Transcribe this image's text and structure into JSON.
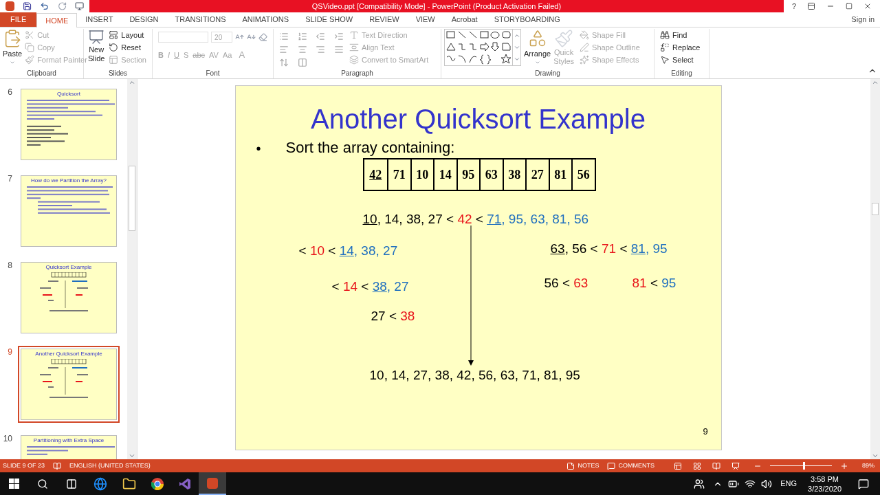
{
  "title_bar": {
    "title": "QSVideo.ppt [Compatibility Mode] - PowerPoint (Product Activation Failed)",
    "help": "?"
  },
  "tabs": [
    {
      "label": "FILE",
      "kind": "file",
      "selected": false
    },
    {
      "label": "HOME",
      "kind": "tab",
      "selected": true
    },
    {
      "label": "INSERT",
      "kind": "tab",
      "selected": false
    },
    {
      "label": "DESIGN",
      "kind": "tab",
      "selected": false
    },
    {
      "label": "TRANSITIONS",
      "kind": "tab",
      "selected": false
    },
    {
      "label": "ANIMATIONS",
      "kind": "tab",
      "selected": false
    },
    {
      "label": "SLIDE SHOW",
      "kind": "tab",
      "selected": false
    },
    {
      "label": "REVIEW",
      "kind": "tab",
      "selected": false
    },
    {
      "label": "VIEW",
      "kind": "tab",
      "selected": false
    },
    {
      "label": "Acrobat",
      "kind": "tab",
      "selected": false
    },
    {
      "label": "STORYBOARDING",
      "kind": "tab",
      "selected": false
    }
  ],
  "sign_in": "Sign in",
  "clipboard": {
    "label": "Clipboard",
    "paste": "Paste",
    "items": [
      {
        "label": "Cut",
        "disabled": true
      },
      {
        "label": "Copy",
        "disabled": true
      },
      {
        "label": "Format Painter",
        "disabled": true
      }
    ]
  },
  "slides_group": {
    "label": "Slides",
    "new_slide": [
      "New",
      "Slide"
    ],
    "items": [
      {
        "label": "Layout",
        "disabled": false
      },
      {
        "label": "Reset",
        "disabled": false
      },
      {
        "label": "Section",
        "disabled": true
      }
    ]
  },
  "font": {
    "label": "Font",
    "size": "20",
    "buttons": [
      "B",
      "I",
      "U",
      "S",
      "abc",
      "AV",
      "Aa",
      "A"
    ]
  },
  "paragraph": {
    "label": "Paragraph",
    "items": [
      {
        "label": "Text Direction",
        "disabled": true
      },
      {
        "label": "Align Text",
        "disabled": true
      },
      {
        "label": "Convert to SmartArt",
        "disabled": true
      }
    ]
  },
  "drawing": {
    "label": "Drawing",
    "arrange": "Arrange",
    "quick_styles": [
      "Quick",
      "Styles"
    ],
    "items": [
      {
        "label": "Shape Fill",
        "disabled": true
      },
      {
        "label": "Shape Outline",
        "disabled": true
      },
      {
        "label": "Shape Effects",
        "disabled": true
      }
    ]
  },
  "editing": {
    "label": "Editing",
    "items": [
      {
        "label": "Find",
        "disabled": false
      },
      {
        "label": "Replace",
        "disabled": false
      },
      {
        "label": "Select",
        "disabled": false
      }
    ]
  },
  "thumbnails": [
    {
      "number": "6",
      "title": "Quicksort",
      "selected": false
    },
    {
      "number": "7",
      "title": "How do we Partition the Array?",
      "selected": false
    },
    {
      "number": "8",
      "title": "Quicksort Example",
      "selected": false
    },
    {
      "number": "9",
      "title": "Another Quicksort Example",
      "selected": true
    },
    {
      "number": "10",
      "title": "Partitioning with Extra Space",
      "selected": false
    }
  ],
  "slide": {
    "title": "Another Quicksort Example",
    "bullet": "•",
    "subtitle": "Sort the array containing:",
    "array": [
      {
        "text": "42",
        "underlined": true
      },
      {
        "text": "71",
        "underlined": false
      },
      {
        "text": "10",
        "underlined": false
      },
      {
        "text": "14",
        "underlined": false
      },
      {
        "text": "95",
        "underlined": false
      },
      {
        "text": "63",
        "underlined": false
      },
      {
        "text": "38",
        "underlined": false
      },
      {
        "text": "27",
        "underlined": false
      },
      {
        "text": "81",
        "underlined": false
      },
      {
        "text": "56",
        "underlined": false
      }
    ],
    "lines": [
      {
        "tokens": [
          {
            "text": "10",
            "color": "#000000",
            "underlined": true
          },
          {
            "text": ", 14, 38, 27 < ",
            "color": "#000000",
            "underlined": false
          },
          {
            "text": "42",
            "color": "#e8141a",
            "underlined": false
          },
          {
            "text": " < ",
            "color": "#000000",
            "underlined": false
          },
          {
            "text": "71",
            "color": "#1f6fbf",
            "underlined": true
          },
          {
            "text": ", 95, 63, 81, 56",
            "color": "#1f6fbf",
            "underlined": false
          }
        ]
      },
      {
        "tokens": [
          {
            "text": "< ",
            "color": "#000000",
            "underlined": false
          },
          {
            "text": "10",
            "color": "#e8141a",
            "underlined": false
          },
          {
            "text": " < ",
            "color": "#000000",
            "underlined": false
          },
          {
            "text": "14",
            "color": "#1f6fbf",
            "underlined": true
          },
          {
            "text": ", 38, 27",
            "color": "#1f6fbf",
            "underlined": false
          }
        ]
      },
      {
        "tokens": [
          {
            "text": "63",
            "color": "#000000",
            "underlined": true
          },
          {
            "text": ", 56 < ",
            "color": "#000000",
            "underlined": false
          },
          {
            "text": "71",
            "color": "#e8141a",
            "underlined": false
          },
          {
            "text": " < ",
            "color": "#000000",
            "underlined": false
          },
          {
            "text": "81",
            "color": "#1f6fbf",
            "underlined": true
          },
          {
            "text": ", 95",
            "color": "#1f6fbf",
            "underlined": false
          }
        ]
      },
      {
        "tokens": [
          {
            "text": "< ",
            "color": "#000000",
            "underlined": false
          },
          {
            "text": "14",
            "color": "#e8141a",
            "underlined": false
          },
          {
            "text": " < ",
            "color": "#000000",
            "underlined": false
          },
          {
            "text": "38",
            "color": "#1f6fbf",
            "underlined": true
          },
          {
            "text": ", 27",
            "color": "#1f6fbf",
            "underlined": false
          }
        ]
      },
      {
        "tokens": [
          {
            "text": "56 < ",
            "color": "#000000",
            "underlined": false
          },
          {
            "text": "63",
            "color": "#e8141a",
            "underlined": false
          }
        ]
      },
      {
        "tokens": [
          {
            "text": "81",
            "color": "#e8141a",
            "underlined": false
          },
          {
            "text": " < ",
            "color": "#000000",
            "underlined": false
          },
          {
            "text": "95",
            "color": "#1f6fbf",
            "underlined": false
          }
        ]
      },
      {
        "tokens": [
          {
            "text": "27 < ",
            "color": "#000000",
            "underlined": false
          },
          {
            "text": "38",
            "color": "#e8141a",
            "underlined": false
          }
        ]
      },
      {
        "tokens": [
          {
            "text": "10, 14, 27, 38, 42, 56, 63, 71, 81, 95",
            "color": "#000000",
            "underlined": false
          }
        ]
      }
    ],
    "page_number": "9"
  },
  "status_bar": {
    "slide": "SLIDE 9 OF 23",
    "language": "ENGLISH (UNITED STATES)",
    "notes": "NOTES",
    "comments": "COMMENTS",
    "zoom": "89%",
    "level": 0.55
  },
  "taskbar": {
    "language": "ENG",
    "time": "3:58 PM",
    "date": "3/23/2020"
  }
}
